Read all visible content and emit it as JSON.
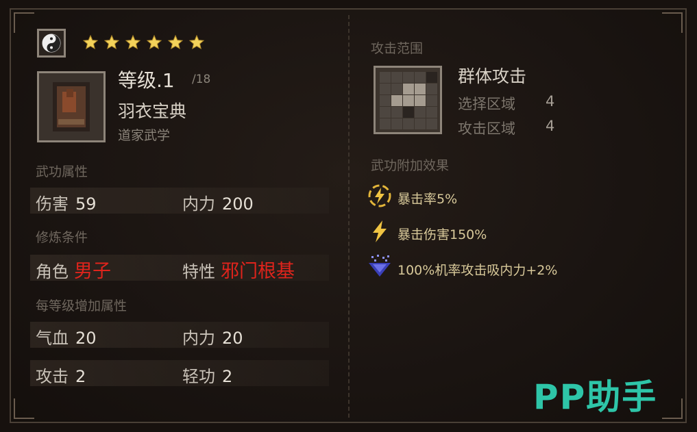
{
  "item": {
    "stars": 6,
    "level_label": "等级.1",
    "level_max": "/18",
    "name": "羽衣宝典",
    "category": "道家武学"
  },
  "attributes": {
    "title": "武功属性",
    "damage_label": "伤害",
    "damage_value": "59",
    "inner_label": "内力",
    "inner_value": "200"
  },
  "requirements": {
    "title": "修炼条件",
    "role_label": "角色",
    "role_value": "男子",
    "trait_label": "特性",
    "trait_value": "邪门根基"
  },
  "per_level": {
    "title": "每等级增加属性",
    "hp_label": "气血",
    "hp_value": "20",
    "mp_label": "内力",
    "mp_value": "20",
    "atk_label": "攻击",
    "atk_value": "2",
    "qinggong_label": "轻功",
    "qinggong_value": "2"
  },
  "attack_range": {
    "title": "攻击范围",
    "type": "群体攻击",
    "select_label": "选择区域",
    "select_value": "4",
    "attack_label": "攻击区域",
    "attack_value": "4"
  },
  "effects": {
    "title": "武功附加效果",
    "items": [
      {
        "icon": "lightning-circle-icon",
        "text": "暴击率5%"
      },
      {
        "icon": "lightning-icon",
        "text": "暴击伤害150%"
      },
      {
        "icon": "absorb-icon",
        "text": "100%机率攻击吸内力+2%"
      }
    ]
  },
  "watermark": "PP助手",
  "colors": {
    "requirement_red": "#e0241c",
    "star_gold": "#f3d25a",
    "watermark": "#2ec5a8"
  }
}
